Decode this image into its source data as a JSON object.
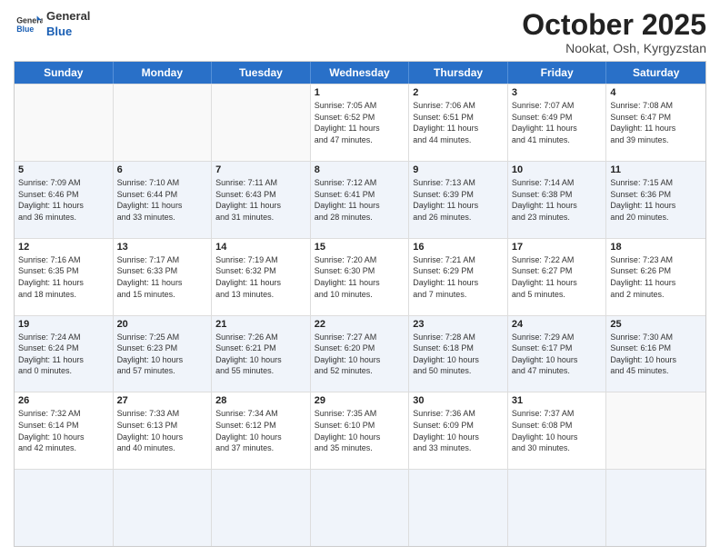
{
  "header": {
    "logo_line1": "General",
    "logo_line2": "Blue",
    "month": "October 2025",
    "location": "Nookat, Osh, Kyrgyzstan"
  },
  "weekdays": [
    "Sunday",
    "Monday",
    "Tuesday",
    "Wednesday",
    "Thursday",
    "Friday",
    "Saturday"
  ],
  "rows": [
    {
      "alt": false,
      "cells": [
        {
          "day": "",
          "lines": []
        },
        {
          "day": "",
          "lines": []
        },
        {
          "day": "",
          "lines": []
        },
        {
          "day": "1",
          "lines": [
            "Sunrise: 7:05 AM",
            "Sunset: 6:52 PM",
            "Daylight: 11 hours",
            "and 47 minutes."
          ]
        },
        {
          "day": "2",
          "lines": [
            "Sunrise: 7:06 AM",
            "Sunset: 6:51 PM",
            "Daylight: 11 hours",
            "and 44 minutes."
          ]
        },
        {
          "day": "3",
          "lines": [
            "Sunrise: 7:07 AM",
            "Sunset: 6:49 PM",
            "Daylight: 11 hours",
            "and 41 minutes."
          ]
        },
        {
          "day": "4",
          "lines": [
            "Sunrise: 7:08 AM",
            "Sunset: 6:47 PM",
            "Daylight: 11 hours",
            "and 39 minutes."
          ]
        }
      ]
    },
    {
      "alt": true,
      "cells": [
        {
          "day": "5",
          "lines": [
            "Sunrise: 7:09 AM",
            "Sunset: 6:46 PM",
            "Daylight: 11 hours",
            "and 36 minutes."
          ]
        },
        {
          "day": "6",
          "lines": [
            "Sunrise: 7:10 AM",
            "Sunset: 6:44 PM",
            "Daylight: 11 hours",
            "and 33 minutes."
          ]
        },
        {
          "day": "7",
          "lines": [
            "Sunrise: 7:11 AM",
            "Sunset: 6:43 PM",
            "Daylight: 11 hours",
            "and 31 minutes."
          ]
        },
        {
          "day": "8",
          "lines": [
            "Sunrise: 7:12 AM",
            "Sunset: 6:41 PM",
            "Daylight: 11 hours",
            "and 28 minutes."
          ]
        },
        {
          "day": "9",
          "lines": [
            "Sunrise: 7:13 AM",
            "Sunset: 6:39 PM",
            "Daylight: 11 hours",
            "and 26 minutes."
          ]
        },
        {
          "day": "10",
          "lines": [
            "Sunrise: 7:14 AM",
            "Sunset: 6:38 PM",
            "Daylight: 11 hours",
            "and 23 minutes."
          ]
        },
        {
          "day": "11",
          "lines": [
            "Sunrise: 7:15 AM",
            "Sunset: 6:36 PM",
            "Daylight: 11 hours",
            "and 20 minutes."
          ]
        }
      ]
    },
    {
      "alt": false,
      "cells": [
        {
          "day": "12",
          "lines": [
            "Sunrise: 7:16 AM",
            "Sunset: 6:35 PM",
            "Daylight: 11 hours",
            "and 18 minutes."
          ]
        },
        {
          "day": "13",
          "lines": [
            "Sunrise: 7:17 AM",
            "Sunset: 6:33 PM",
            "Daylight: 11 hours",
            "and 15 minutes."
          ]
        },
        {
          "day": "14",
          "lines": [
            "Sunrise: 7:19 AM",
            "Sunset: 6:32 PM",
            "Daylight: 11 hours",
            "and 13 minutes."
          ]
        },
        {
          "day": "15",
          "lines": [
            "Sunrise: 7:20 AM",
            "Sunset: 6:30 PM",
            "Daylight: 11 hours",
            "and 10 minutes."
          ]
        },
        {
          "day": "16",
          "lines": [
            "Sunrise: 7:21 AM",
            "Sunset: 6:29 PM",
            "Daylight: 11 hours",
            "and 7 minutes."
          ]
        },
        {
          "day": "17",
          "lines": [
            "Sunrise: 7:22 AM",
            "Sunset: 6:27 PM",
            "Daylight: 11 hours",
            "and 5 minutes."
          ]
        },
        {
          "day": "18",
          "lines": [
            "Sunrise: 7:23 AM",
            "Sunset: 6:26 PM",
            "Daylight: 11 hours",
            "and 2 minutes."
          ]
        }
      ]
    },
    {
      "alt": true,
      "cells": [
        {
          "day": "19",
          "lines": [
            "Sunrise: 7:24 AM",
            "Sunset: 6:24 PM",
            "Daylight: 11 hours",
            "and 0 minutes."
          ]
        },
        {
          "day": "20",
          "lines": [
            "Sunrise: 7:25 AM",
            "Sunset: 6:23 PM",
            "Daylight: 10 hours",
            "and 57 minutes."
          ]
        },
        {
          "day": "21",
          "lines": [
            "Sunrise: 7:26 AM",
            "Sunset: 6:21 PM",
            "Daylight: 10 hours",
            "and 55 minutes."
          ]
        },
        {
          "day": "22",
          "lines": [
            "Sunrise: 7:27 AM",
            "Sunset: 6:20 PM",
            "Daylight: 10 hours",
            "and 52 minutes."
          ]
        },
        {
          "day": "23",
          "lines": [
            "Sunrise: 7:28 AM",
            "Sunset: 6:18 PM",
            "Daylight: 10 hours",
            "and 50 minutes."
          ]
        },
        {
          "day": "24",
          "lines": [
            "Sunrise: 7:29 AM",
            "Sunset: 6:17 PM",
            "Daylight: 10 hours",
            "and 47 minutes."
          ]
        },
        {
          "day": "25",
          "lines": [
            "Sunrise: 7:30 AM",
            "Sunset: 6:16 PM",
            "Daylight: 10 hours",
            "and 45 minutes."
          ]
        }
      ]
    },
    {
      "alt": false,
      "cells": [
        {
          "day": "26",
          "lines": [
            "Sunrise: 7:32 AM",
            "Sunset: 6:14 PM",
            "Daylight: 10 hours",
            "and 42 minutes."
          ]
        },
        {
          "day": "27",
          "lines": [
            "Sunrise: 7:33 AM",
            "Sunset: 6:13 PM",
            "Daylight: 10 hours",
            "and 40 minutes."
          ]
        },
        {
          "day": "28",
          "lines": [
            "Sunrise: 7:34 AM",
            "Sunset: 6:12 PM",
            "Daylight: 10 hours",
            "and 37 minutes."
          ]
        },
        {
          "day": "29",
          "lines": [
            "Sunrise: 7:35 AM",
            "Sunset: 6:10 PM",
            "Daylight: 10 hours",
            "and 35 minutes."
          ]
        },
        {
          "day": "30",
          "lines": [
            "Sunrise: 7:36 AM",
            "Sunset: 6:09 PM",
            "Daylight: 10 hours",
            "and 33 minutes."
          ]
        },
        {
          "day": "31",
          "lines": [
            "Sunrise: 7:37 AM",
            "Sunset: 6:08 PM",
            "Daylight: 10 hours",
            "and 30 minutes."
          ]
        },
        {
          "day": "",
          "lines": []
        }
      ]
    },
    {
      "alt": true,
      "cells": [
        {
          "day": "",
          "lines": []
        },
        {
          "day": "",
          "lines": []
        },
        {
          "day": "",
          "lines": []
        },
        {
          "day": "",
          "lines": []
        },
        {
          "day": "",
          "lines": []
        },
        {
          "day": "",
          "lines": []
        },
        {
          "day": "",
          "lines": []
        }
      ]
    }
  ]
}
